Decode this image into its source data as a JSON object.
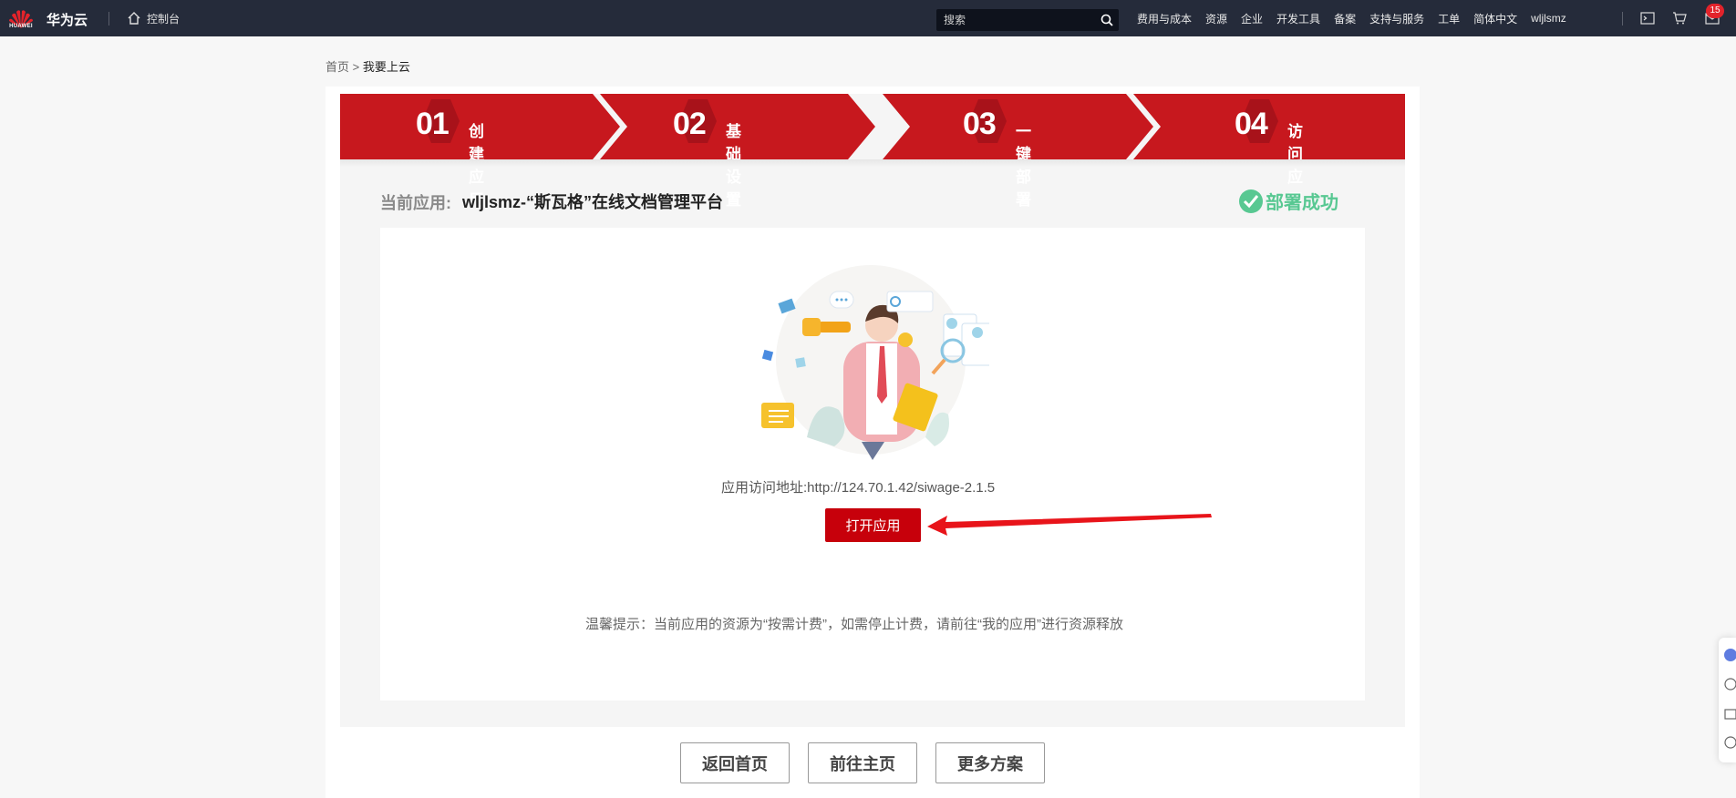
{
  "header": {
    "logo_text": "HUAWEI",
    "brand": "华为云",
    "console": "控制台",
    "search_placeholder": "搜索",
    "nav": [
      "费用与成本",
      "资源",
      "企业",
      "开发工具",
      "备案",
      "支持与服务",
      "工单",
      "简体中文",
      "wljlsmz"
    ],
    "message_count": "15"
  },
  "breadcrumb": {
    "home": "首页",
    "separator": ">",
    "current": "我要上云"
  },
  "steps": [
    {
      "num": "01",
      "label": "创建应用"
    },
    {
      "num": "02",
      "label": "基础设置"
    },
    {
      "num": "03",
      "label": "一键部署"
    },
    {
      "num": "04",
      "label": "访问应用"
    }
  ],
  "app": {
    "label": "当前应用:",
    "name": "wljlsmz-“斯瓦格”在线文档管理平台",
    "status": "部署成功"
  },
  "access": {
    "label": "应用访问地址:",
    "url": "http://124.70.1.42/siwage-2.1.5",
    "open_button": "打开应用"
  },
  "tip": "温馨提示：当前应用的资源为“按需计费”，如需停止计费，请前往“我的应用”进行资源释放",
  "buttons": {
    "home": "返回首页",
    "main": "前往主页",
    "more": "更多方案"
  },
  "colors": {
    "brand_red": "#c7000b",
    "topbar": "#252b3a",
    "success_green": "#58c892"
  }
}
